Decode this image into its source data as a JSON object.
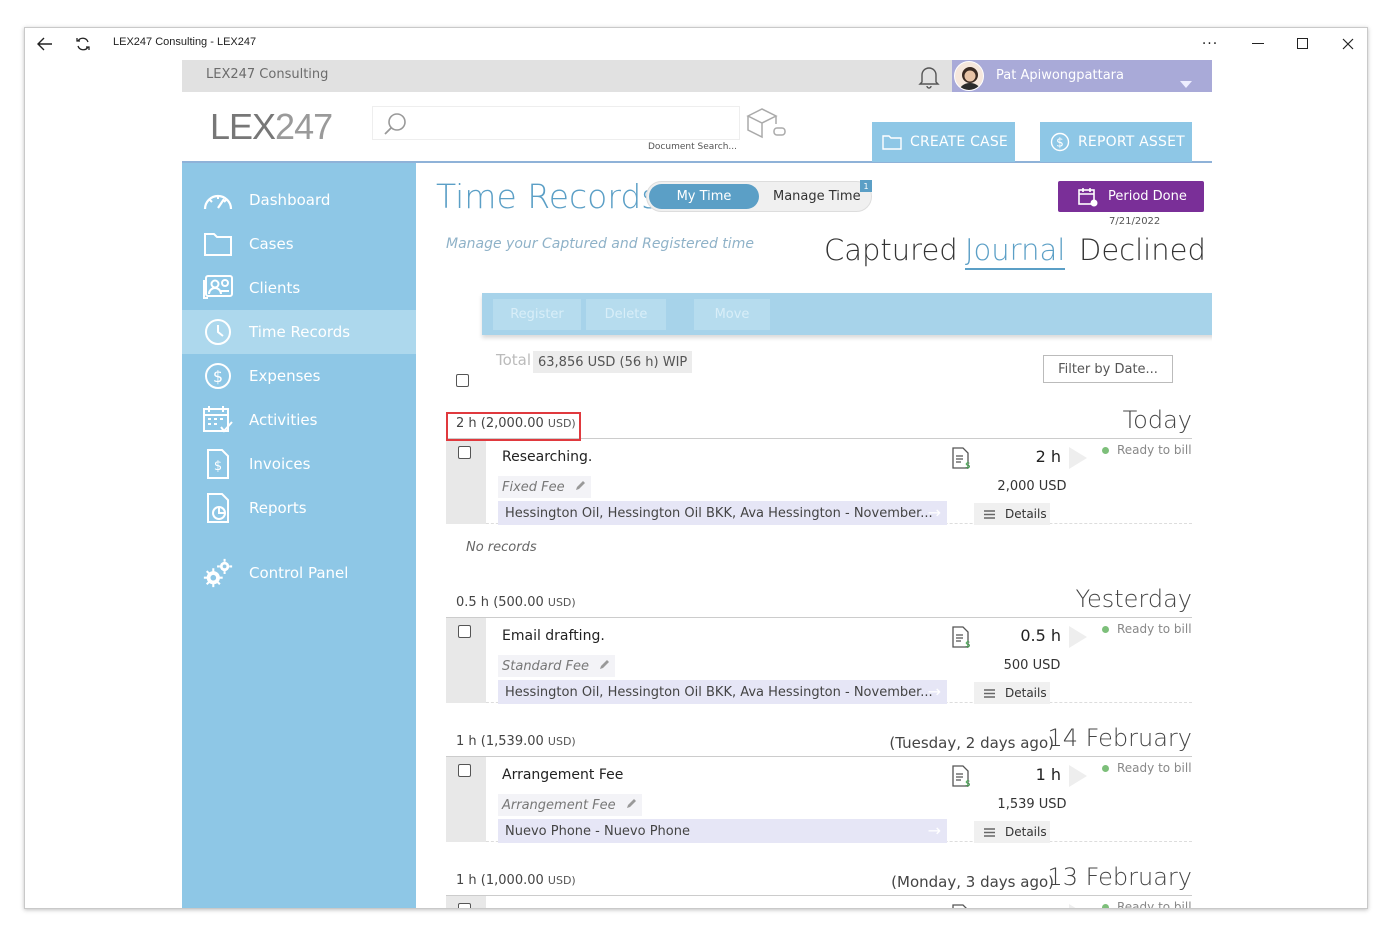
{
  "window": {
    "title": "LEX247 Consulting - LEX247",
    "more_label": "···"
  },
  "app": {
    "org_name": "LEX247 Consulting",
    "user_name": "Pat Apiwongpattara",
    "logo_bold": "LEX",
    "logo_thin": "247",
    "search_hint": "Document Search...",
    "create_case": "CREATE CASE",
    "report_asset": "REPORT ASSET"
  },
  "sidebar": {
    "items": [
      {
        "label": "Dashboard",
        "icon": "speedometer-icon"
      },
      {
        "label": "Cases",
        "icon": "folder-icon"
      },
      {
        "label": "Clients",
        "icon": "contacts-icon"
      },
      {
        "label": "Time Records",
        "icon": "clock-icon",
        "active": true
      },
      {
        "label": "Expenses",
        "icon": "dollar-circle-icon"
      },
      {
        "label": "Activities",
        "icon": "calendar-check-icon"
      },
      {
        "label": "Invoices",
        "icon": "invoice-icon"
      },
      {
        "label": "Reports",
        "icon": "report-icon"
      },
      {
        "label": "Control Panel",
        "icon": "gears-icon"
      }
    ]
  },
  "main": {
    "title": "Time Records",
    "toggle_on": "My Time",
    "toggle_off": "Manage Time",
    "toggle_badge": "1",
    "period_done": "Period Done",
    "period_date": "7/21/2022",
    "subtitle": "Manage your Captured and Registered time",
    "tabs": [
      "Captured",
      "Journal",
      "Declined"
    ],
    "active_tab": "Journal",
    "actions": [
      "Register",
      "Delete",
      "Move"
    ],
    "total_label": "Total",
    "total_value": "63,856 USD (56 h)  WIP",
    "filter_label": "Filter by Date...",
    "no_records": "No records",
    "details_label": "Details",
    "groups": [
      {
        "hours": "2 h",
        "amount": "(2,000.00",
        "unit": "USD)",
        "relative": "",
        "date": "Today",
        "record": {
          "description": "Researching.",
          "fee": "Fixed Fee",
          "matter": "Hessington Oil, Hessington Oil BKK, Ava Hessington - November...",
          "hours": "2 h",
          "amount": "2,000 USD",
          "status": "Ready to bill"
        }
      },
      {
        "hours": "0.5 h",
        "amount": "(500.00",
        "unit": "USD)",
        "relative": "",
        "date": "Yesterday",
        "record": {
          "description": "Email drafting.",
          "fee": "Standard Fee",
          "matter": "Hessington Oil, Hessington Oil BKK, Ava Hessington - November...",
          "hours": "0.5 h",
          "amount": "500 USD",
          "status": "Ready to bill"
        }
      },
      {
        "hours": "1 h",
        "amount": "(1,539.00",
        "unit": "USD)",
        "relative": "(Tuesday, 2 days ago)",
        "date": "14 February",
        "record": {
          "description": "Arrangement Fee",
          "fee": "Arrangement Fee",
          "matter": "Nuevo Phone - Nuevo Phone",
          "hours": "1 h",
          "amount": "1,539 USD",
          "status": "Ready to bill"
        }
      },
      {
        "hours": "1 h",
        "amount": "(1,000.00",
        "unit": "USD)",
        "relative": "(Monday, 3 days ago)",
        "date": "13 February",
        "record": {
          "status": "Ready to bill"
        }
      }
    ]
  },
  "colors": {
    "sidebar": "#8ec7e6",
    "accent": "#5b9fc6",
    "period": "#7a2f98",
    "highlight": "#e0393e"
  }
}
